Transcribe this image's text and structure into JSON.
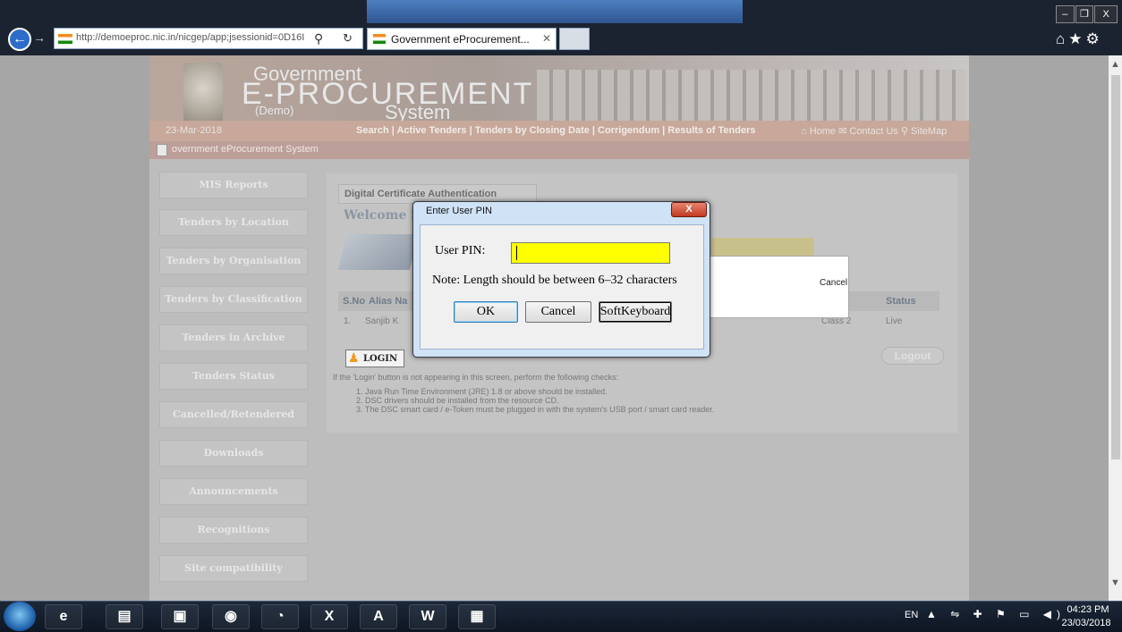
{
  "browser": {
    "address": "http://demoeproc.nic.in/nicgep/app;jsessionid=0D16I",
    "address_host": "nic.in",
    "tab_label": "Government eProcurement...",
    "tab_close": "✕",
    "back": "←",
    "forward": "→",
    "search_icon": "⚲",
    "refresh_icon": "↻",
    "window_minimize": "–",
    "window_restore": "❐",
    "window_close": "X",
    "toolbar_icons": "⌂★⚙"
  },
  "site": {
    "brand_line1": "Government",
    "brand_line2": "E-PROCUREMENT",
    "brand_demo": "(Demo)",
    "brand_line3": "System",
    "date": "23-Mar-2018",
    "nav_links": "Search  |  Active Tenders  |  Tenders by Closing Date  |  Corrigendum  |  Results of Tenders",
    "nav_right": "⌂ Home   ✉ Contact Us   ⚲ SiteMap",
    "breadcrumb": "overnment eProcurement System"
  },
  "menu": [
    {
      "label": "MIS Reports"
    },
    {
      "label": "Tenders by Location"
    },
    {
      "label": "Tenders by Organisation"
    },
    {
      "label": "Tenders by Classification"
    },
    {
      "label": "Tenders in Archive"
    },
    {
      "label": "Tenders Status"
    },
    {
      "label": "Cancelled/Retendered"
    },
    {
      "label": "Downloads"
    },
    {
      "label": "Announcements"
    },
    {
      "label": "Recognitions"
    },
    {
      "label": "Site compatibility"
    }
  ],
  "main": {
    "dca_title": "Digital Certificate Authentication",
    "welcome": "Welcome Sk",
    "table_headers": {
      "sno": "S.No",
      "alias": "Alias Na",
      "status": "Status"
    },
    "row": {
      "sno": "1.",
      "name": "Sanjib K",
      "class": "Class 2",
      "status": "Live"
    },
    "cancel_popup": "Cancel",
    "login_label": "LOGIN",
    "logout_label": "Logout",
    "note_intro": "If the 'Login' button is not appearing in this screen, perform the following checks:",
    "notes": [
      "1.  Java Run Time Environment (JRE) 1.8 or above should be installed.",
      "2.  DSC drivers should be installed from the resource CD.",
      "3.  The DSC smart card / e-Token must be plugged in with the system's USB port / smart card reader."
    ]
  },
  "dialog": {
    "title": "Enter User PIN",
    "close": "X",
    "pin_label": "User PIN:",
    "pin_value": "",
    "note": "Note: Length should be between 6–32 characters",
    "ok": "OK",
    "cancel": "Cancel",
    "softkeyboard": "SoftKeyboard"
  },
  "taskbar": {
    "apps": [
      "e",
      "▤",
      "▣",
      "◉",
      "◔",
      "X",
      "A",
      "W",
      "▦"
    ],
    "lang": "EN",
    "tray": "▲ ⇋ ✚ ⚑ ▭ ◀)",
    "time": "04:23 PM",
    "date": "23/03/2018"
  },
  "colors": {
    "pin_field": "#ffff00",
    "dialog_close": "#c23a22",
    "nav_bar": "#c7a89a"
  }
}
